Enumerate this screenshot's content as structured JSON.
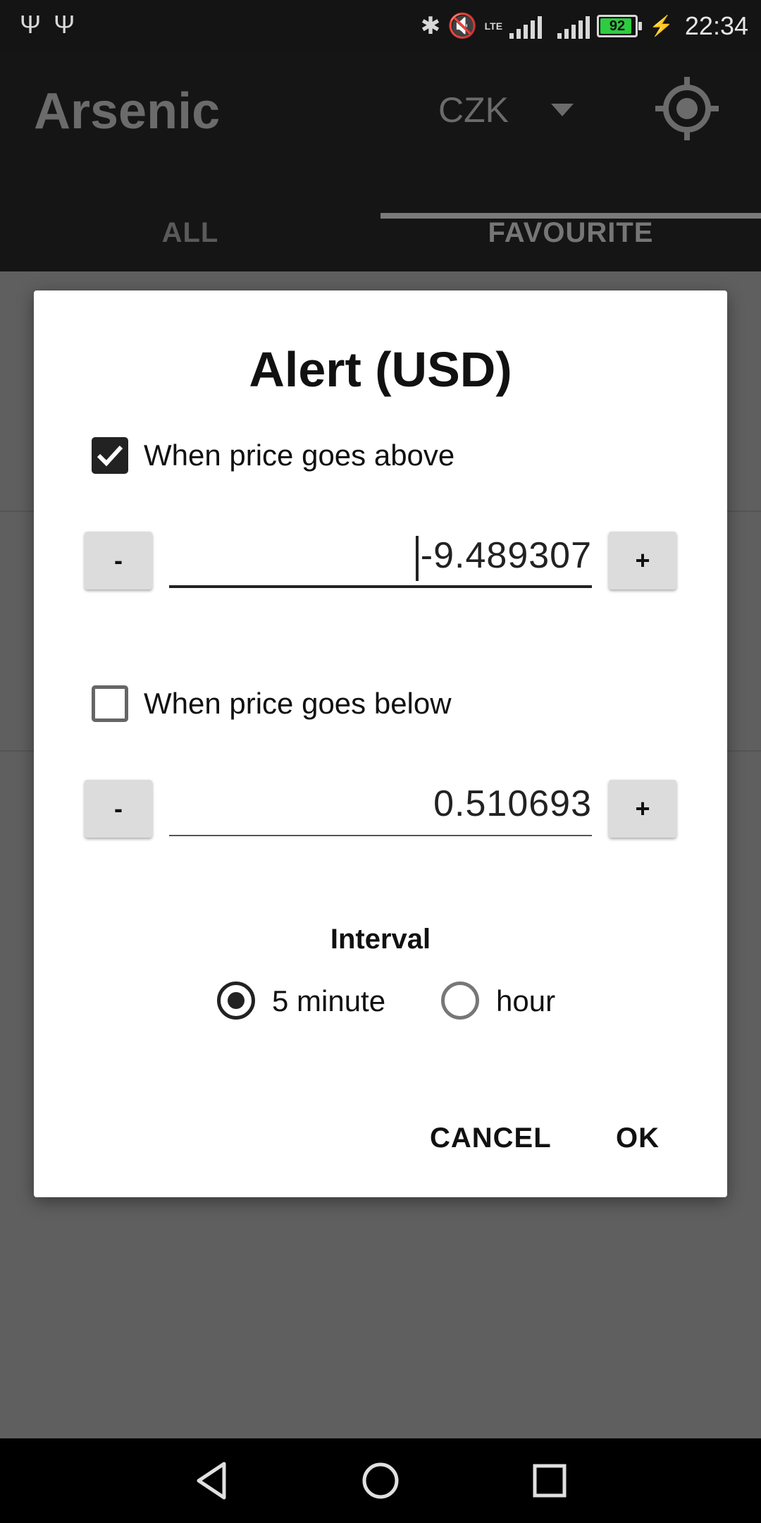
{
  "status_bar": {
    "time": "22:34",
    "battery": "92",
    "network": "LTE"
  },
  "app_bar": {
    "title": "Arsenic",
    "currency": "CZK"
  },
  "tabs": [
    {
      "label": "ALL",
      "selected": false
    },
    {
      "label": "FAVOURITE",
      "selected": true
    }
  ],
  "dialog": {
    "title": "Alert (USD)",
    "above": {
      "checked": true,
      "label": "When price goes above",
      "value": "-9.489307",
      "minus": "-",
      "plus": "+"
    },
    "below": {
      "checked": false,
      "label": "When price goes below",
      "value": "0.510693",
      "minus": "-",
      "plus": "+"
    },
    "interval": {
      "label": "Interval",
      "options": [
        {
          "label": "5 minute",
          "selected": true
        },
        {
          "label": "hour",
          "selected": false
        }
      ]
    },
    "actions": {
      "cancel": "CANCEL",
      "ok": "OK"
    }
  },
  "colors": {
    "scrim": "#5f5f5f",
    "appbar": "#151515",
    "dialog_bg": "#ffffff",
    "battery_fill": "#2ecc40"
  }
}
